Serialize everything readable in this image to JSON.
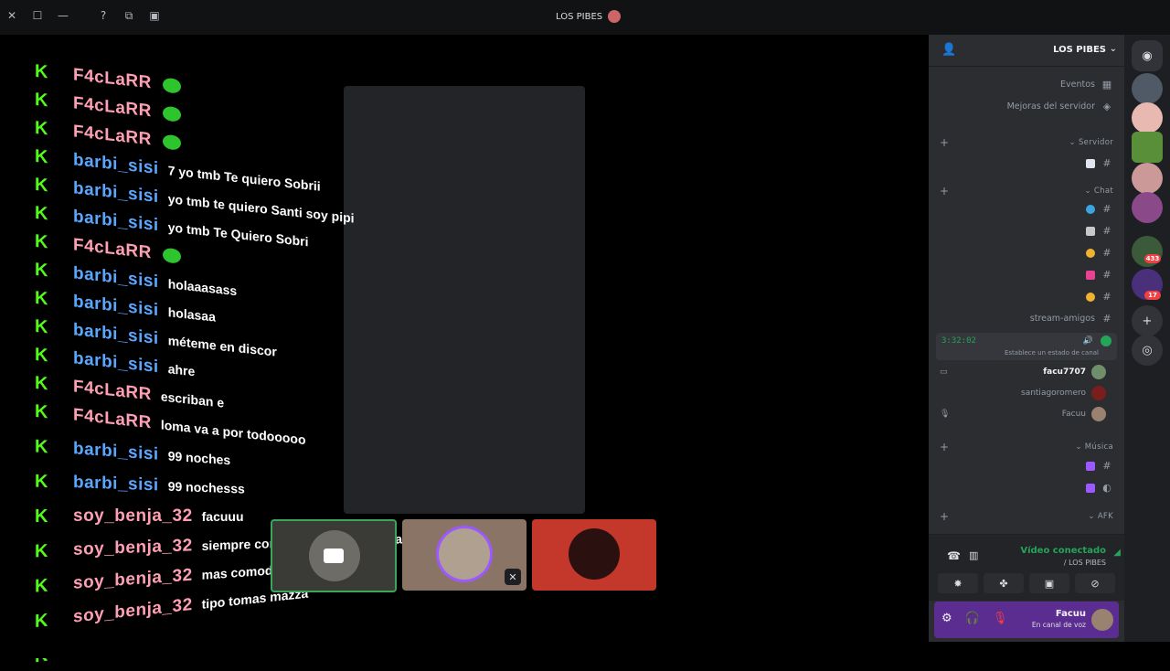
{
  "window": {
    "title": "LOS PIBES",
    "controls": [
      "close",
      "maximize",
      "minimize"
    ],
    "toolbar_icons": [
      "help-icon",
      "popout-icon",
      "inbox-icon"
    ]
  },
  "chat_overlay": {
    "platform_icon": "kick-logo-icon",
    "messages": [
      {
        "user": "F4cLaRR",
        "user_color": "#ff9fb3",
        "text": "",
        "emote": true
      },
      {
        "user": "F4cLaRR",
        "user_color": "#ff9fb3",
        "text": "",
        "emote": true
      },
      {
        "user": "F4cLaRR",
        "user_color": "#ff9fb3",
        "text": "",
        "emote": true
      },
      {
        "user": "barbi_sisi",
        "user_color": "#5aa7ff",
        "text": "7 yo tmb Te quiero Sobrii",
        "emote": false
      },
      {
        "user": "barbi_sisi",
        "user_color": "#5aa7ff",
        "text": "yo tmb te quiero Santi soy pipi",
        "emote": false
      },
      {
        "user": "barbi_sisi",
        "user_color": "#5aa7ff",
        "text": "yo tmb Te Quiero Sobri",
        "emote": false
      },
      {
        "user": "F4cLaRR",
        "user_color": "#ff9fb3",
        "text": "",
        "emote": true
      },
      {
        "user": "barbi_sisi",
        "user_color": "#5aa7ff",
        "text": "holaaasass",
        "emote": false
      },
      {
        "user": "barbi_sisi",
        "user_color": "#5aa7ff",
        "text": "holasaa",
        "emote": false
      },
      {
        "user": "barbi_sisi",
        "user_color": "#5aa7ff",
        "text": "méteme en discor",
        "emote": false
      },
      {
        "user": "barbi_sisi",
        "user_color": "#5aa7ff",
        "text": "ahre",
        "emote": false
      },
      {
        "user": "F4cLaRR",
        "user_color": "#ff9fb3",
        "text": "escriban e",
        "emote": false
      },
      {
        "user": "F4cLaRR",
        "user_color": "#ff9fb3",
        "text": "loma va a por todooooo",
        "emote": false
      },
      {
        "user": "barbi_sisi",
        "user_color": "#5aa7ff",
        "text": "99 noches",
        "emote": false
      },
      {
        "user": "barbi_sisi",
        "user_color": "#5aa7ff",
        "text": "99 nochesss",
        "emote": false
      },
      {
        "user": "soy_benja_32",
        "user_color": "#ff9fb3",
        "text": "facuuu",
        "emote": false
      },
      {
        "user": "soy_benja_32",
        "user_color": "#ff9fb3",
        "text": "siempre con la misma cara de gay",
        "emote": false
      },
      {
        "user": "soy_benja_32",
        "user_color": "#ff9fb3",
        "text": "mas comodo",
        "emote": false
      },
      {
        "user": "soy_benja_32",
        "user_color": "#ff9fb3",
        "text": "tipo tomas mazza",
        "emote": false
      },
      {
        "user": "",
        "user_color": "#ff9fb3",
        "text": "",
        "emote": false
      }
    ]
  },
  "tiles": [
    {
      "name": "camera-tile",
      "muted": false
    },
    {
      "name": "avatar-tile",
      "muted": true
    },
    {
      "name": "avatar-tile",
      "muted": false
    }
  ],
  "server": {
    "name": "LOS PIBES",
    "events_label": "Eventos",
    "boosts_label": "Mejoras del servidor",
    "categories": [
      {
        "label": "Servidor"
      },
      {
        "label": "Chat"
      },
      {
        "label": "Música"
      },
      {
        "label": "AFK"
      }
    ],
    "stream_channel": "stream-amigos",
    "voice": {
      "timer": "3:32:02",
      "status": "Establece un estado de canal",
      "users": [
        "facu7707",
        "santiagoromero",
        "Facuu"
      ]
    }
  },
  "rtc": {
    "title": "Vídeo conectado",
    "subtitle": "/ LOS PIBES"
  },
  "user": {
    "name": "Facuu",
    "status": "En canal de voz"
  },
  "guild_badges": [
    "433",
    "17"
  ],
  "colors": {
    "kick_green": "#53fc18",
    "discord_green": "#23a55a",
    "user_panel": "#5c2d91",
    "danger": "#f23f43"
  }
}
